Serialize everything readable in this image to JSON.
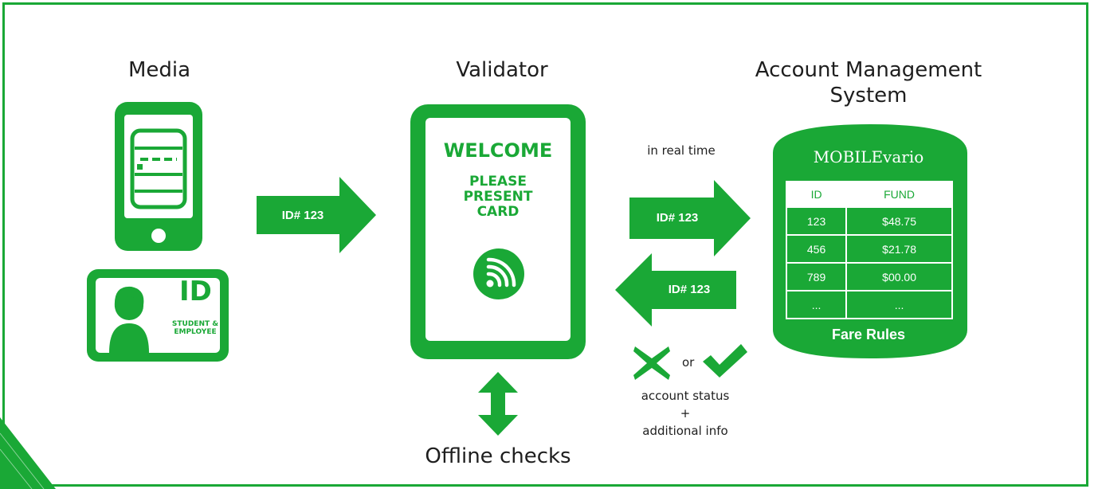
{
  "columns": {
    "media_title": "Media",
    "validator_title": "Validator",
    "ams_title": "Account Management System"
  },
  "media": {
    "id_card_badge": "ID",
    "id_card_caption": "STUDENT & EMPLOYEE"
  },
  "validator": {
    "welcome": "WELCOME",
    "instruction": "PLEASE PRESENT CARD",
    "offline_label": "Offline checks"
  },
  "arrows": {
    "media_to_validator": "ID# 123",
    "validator_to_ams": "ID# 123",
    "ams_to_validator": "ID# 123",
    "realtime_label": "in real time"
  },
  "result": {
    "or_label": "or",
    "status_line1": "account status",
    "status_line2": "+",
    "status_line3": "additional info"
  },
  "ams": {
    "system_name": "MOBILEvario",
    "table_headers": [
      "ID",
      "FUND"
    ],
    "rows": [
      [
        "123",
        "$48.75"
      ],
      [
        "456",
        "$21.78"
      ],
      [
        "789",
        "$00.00"
      ],
      [
        "...",
        "..."
      ]
    ],
    "footer": "Fare Rules"
  },
  "colors": {
    "accent": "#1aa836",
    "background": "#ffffff",
    "text": "#1e1e1e"
  }
}
